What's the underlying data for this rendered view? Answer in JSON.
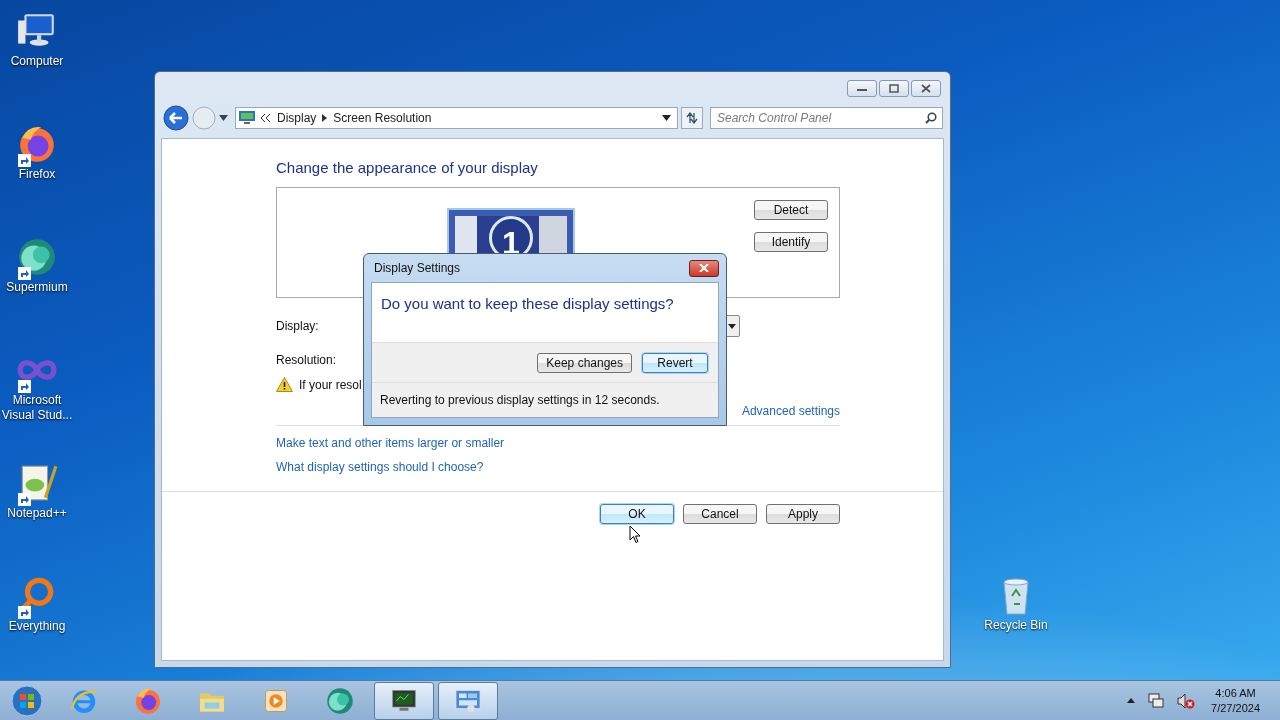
{
  "desktop_icons": [
    {
      "label": "Computer",
      "kind": "computer"
    },
    {
      "label": "Firefox",
      "kind": "firefox"
    },
    {
      "label": "Supermium",
      "kind": "supermium"
    },
    {
      "label": "Microsoft Visual Stud...",
      "kind": "visualstudio"
    },
    {
      "label": "Notepad++",
      "kind": "notepad"
    },
    {
      "label": "Everything",
      "kind": "everything"
    }
  ],
  "recycle_bin": {
    "label": "Recycle Bin"
  },
  "window": {
    "crumbs": [
      "Display",
      "Screen Resolution"
    ],
    "search": {
      "placeholder": "Search Control Panel"
    },
    "heading": "Change the appearance of your display",
    "monitor_number": "1",
    "side_buttons": [
      "Detect",
      "Identify"
    ],
    "display_label": "Display:",
    "resolution_label": "Resolution:",
    "warning": "If your resol",
    "advanced_link": "Advanced settings",
    "links": [
      "Make text and other items larger or smaller",
      "What display settings should I choose?"
    ],
    "footer_buttons": [
      {
        "label": "OK",
        "default": true
      },
      {
        "label": "Cancel",
        "default": false
      },
      {
        "label": "Apply",
        "default": false
      }
    ]
  },
  "dialog": {
    "title": "Display Settings",
    "question": "Do you want to keep these display settings?",
    "buttons": [
      {
        "label": "Keep changes",
        "default": false
      },
      {
        "label": "Revert",
        "default": true
      }
    ],
    "countdown": "Reverting to previous display settings in 12 seconds."
  },
  "taskbar": {
    "apps": [
      {
        "kind": "ie",
        "active": false
      },
      {
        "kind": "firefox",
        "active": false
      },
      {
        "kind": "explorer",
        "active": false
      },
      {
        "kind": "media",
        "active": false
      },
      {
        "kind": "supermium",
        "active": false
      },
      {
        "kind": "monitor",
        "active": true
      },
      {
        "kind": "controlpanel",
        "active": true
      }
    ],
    "time": "4:06 AM",
    "date": "7/27/2024"
  }
}
